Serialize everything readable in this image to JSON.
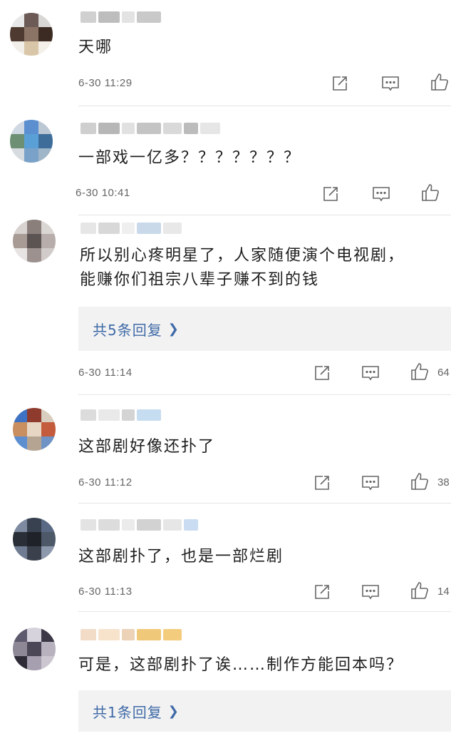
{
  "comments": [
    {
      "text_lines": [
        "天哪"
      ],
      "time": "6-30 11:29",
      "likes": "",
      "replies": "",
      "avatar_colors": [
        "#e8e8e8",
        "#6b5a55",
        "#d9d6d6",
        "#4e3a30",
        "#8b7366",
        "#3b2b23",
        "#f2eeea",
        "#d9c6a8",
        "#f4efe9"
      ],
      "name_colors": [
        "#d0d0d0",
        "#bdbdbd",
        "#e3e3e3",
        "#c9c9c9"
      ]
    },
    {
      "text_lines": [
        "一部戏一亿多？？？？？？？"
      ],
      "time": "6-30 10:41",
      "likes": "",
      "replies": "",
      "avatar_colors": [
        "#cfd8e3",
        "#5b8fd0",
        "#bcc7d4",
        "#6d8f73",
        "#5aa0d6",
        "#3f6d9a",
        "#d7dce1",
        "#7aa2c8",
        "#9fb6c8"
      ],
      "name_colors": [
        "#cfcfcf",
        "#b7b7b7",
        "#e1e1e1",
        "#c4c4c4",
        "#d9d9d9",
        "#bcbcbc",
        "#e6e6e6"
      ]
    },
    {
      "text_lines": [
        "所以别心疼明星了，人家随便演个电视剧，",
        "能赚你们祖宗八辈子赚不到的钱"
      ],
      "time": "6-30 11:14",
      "likes": "64",
      "replies": "共5条回复",
      "avatar_colors": [
        "#d8d3d1",
        "#8b7f7c",
        "#dad6d4",
        "#a89b96",
        "#5c5452",
        "#b7aeab",
        "#e6e3e2",
        "#9c918e",
        "#d1cbc9"
      ],
      "name_colors": [
        "#e6e6e6",
        "#d8d8d8",
        "#efefef",
        "#c9d9ea",
        "#e8e8e8"
      ]
    },
    {
      "text_lines": [
        "这部剧好像还扑了"
      ],
      "time": "6-30 11:12",
      "likes": "38",
      "replies": "",
      "avatar_colors": [
        "#3f72c2",
        "#8e3b2e",
        "#d9cdbf",
        "#c98f60",
        "#e8d6c5",
        "#c35b3c",
        "#5d8fd0",
        "#b6a493",
        "#6f93c4"
      ],
      "name_colors": [
        "#dcdcdc",
        "#e9e9e9",
        "#d4d4d4",
        "#c6dcf0"
      ]
    },
    {
      "text_lines": [
        "这部剧扑了，也是一部烂剧"
      ],
      "time": "6-30 11:13",
      "likes": "14",
      "replies": "",
      "avatar_colors": [
        "#7d8aa0",
        "#38414f",
        "#5a6a84",
        "#2a2f37",
        "#1f2329",
        "#4d5968",
        "#6f7c91",
        "#3a414c",
        "#8c98ab"
      ],
      "name_colors": [
        "#e3e3e3",
        "#dcdcdc",
        "#ebebeb",
        "#d2d2d2",
        "#e6e6e6",
        "#c9dcf1"
      ]
    },
    {
      "text_lines": [
        "可是，这部剧扑了诶……制作方能回本吗？"
      ],
      "time": "",
      "likes": "",
      "replies": "共1条回复",
      "avatar_colors": [
        "#5e5a6d",
        "#d7d3dc",
        "#3d3846",
        "#8e8796",
        "#4c4756",
        "#b8b2bf",
        "#2f2b36",
        "#a69fb0",
        "#cbc6d0"
      ],
      "name_colors": [
        "#f2dcc8",
        "#f7e3cc",
        "#ecd2b6",
        "#f0c879",
        "#f3cc7e"
      ]
    }
  ]
}
